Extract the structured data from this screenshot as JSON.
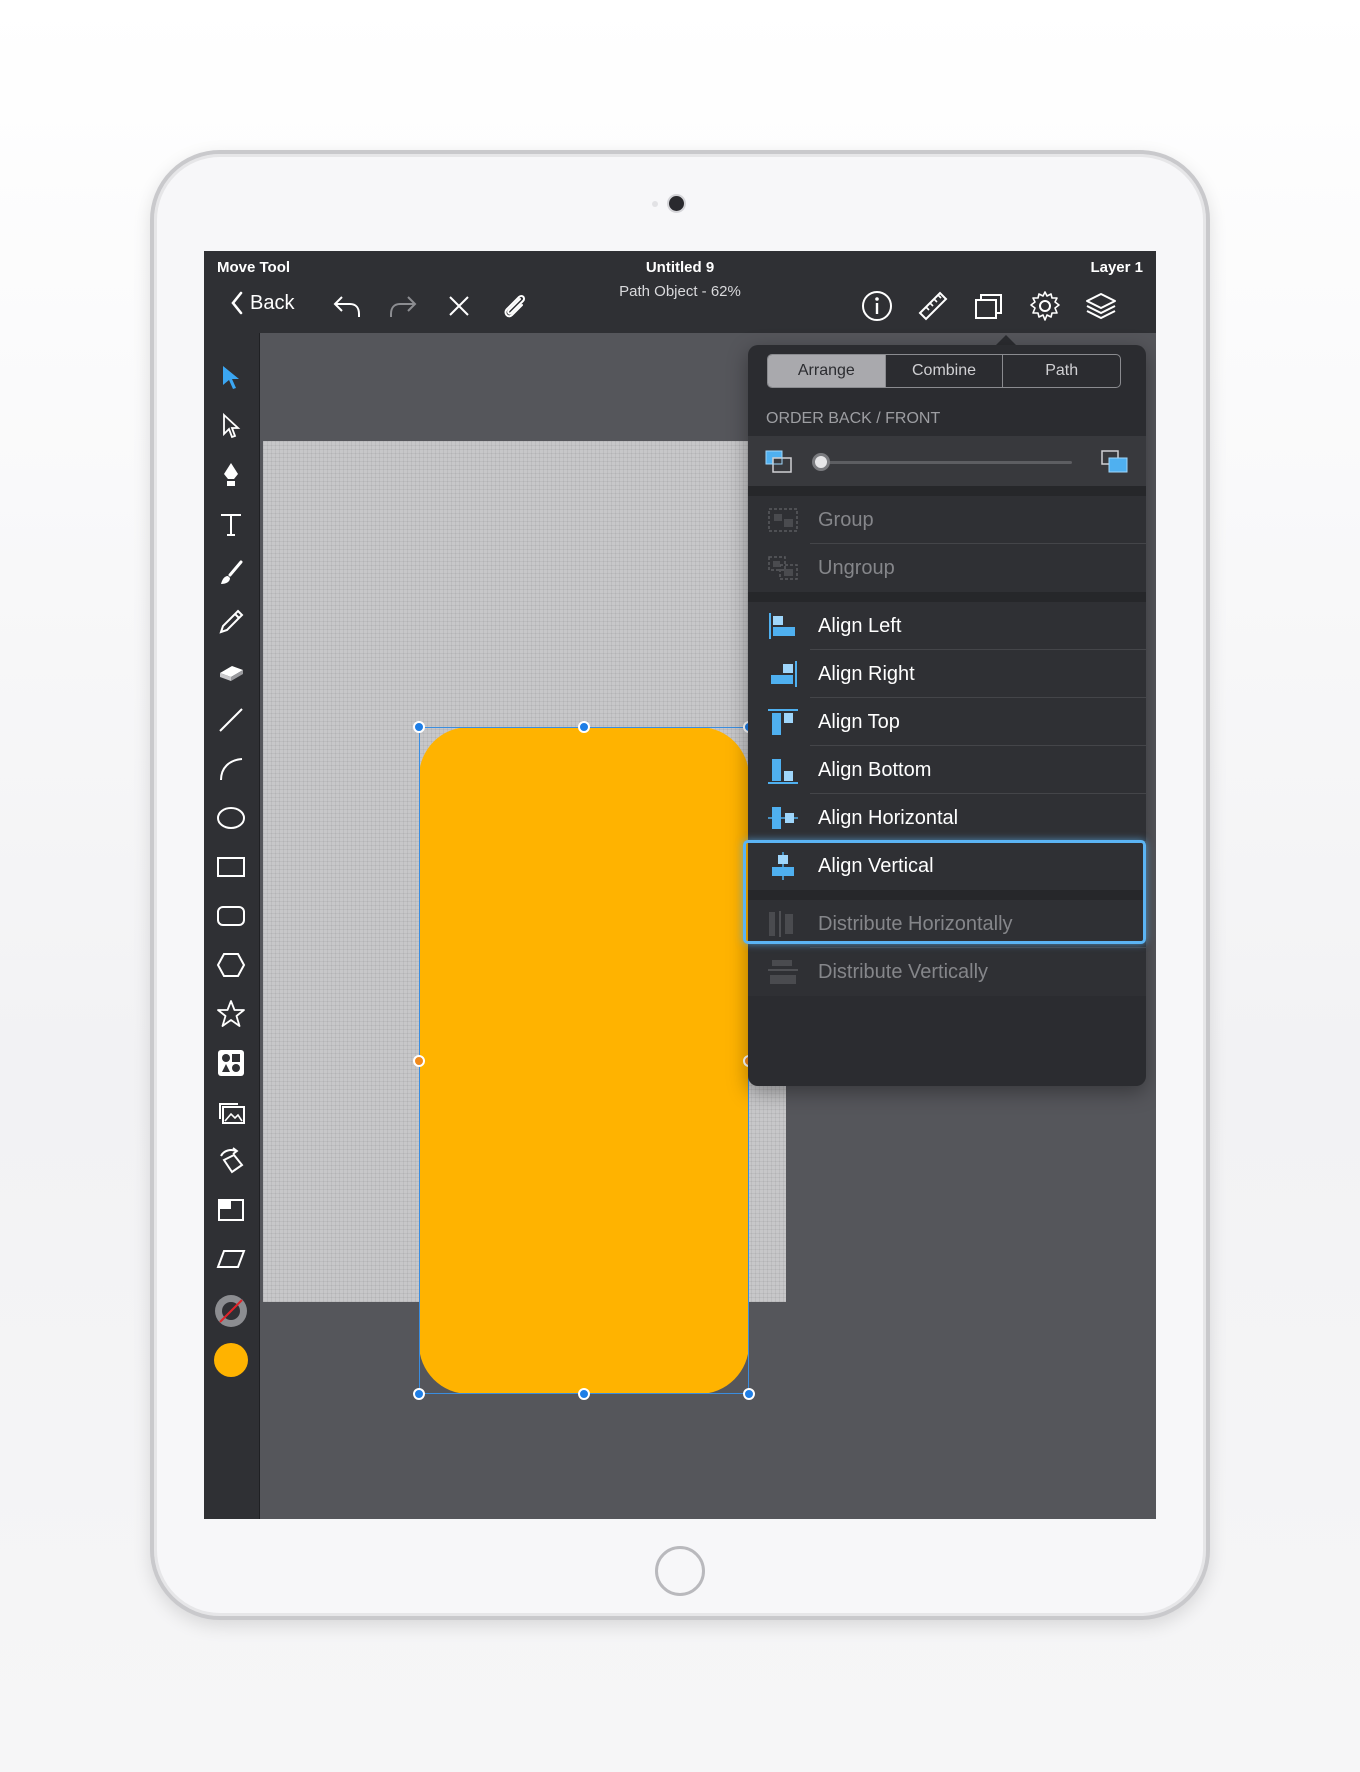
{
  "topbar": {
    "tool_name": "Move Tool",
    "doc_title": "Untitled 9",
    "doc_subtitle": "Path Object - 62%",
    "layer_name": "Layer 1",
    "back_label": "Back"
  },
  "popover": {
    "tabs": [
      "Arrange",
      "Combine",
      "Path"
    ],
    "active_tab": "Arrange",
    "order_section_label": "ORDER BACK / FRONT",
    "order_slider_value": 0,
    "items": {
      "group": "Group",
      "ungroup": "Ungroup",
      "align_left": "Align Left",
      "align_right": "Align Right",
      "align_top": "Align Top",
      "align_bottom": "Align Bottom",
      "align_horizontal": "Align Horizontal",
      "align_vertical": "Align Vertical",
      "distribute_horizontally": "Distribute Horizontally",
      "distribute_vertically": "Distribute Vertically"
    }
  },
  "colors": {
    "fill": "#ffb300",
    "accent": "#4fb0f0",
    "selection": "#1e7ee6"
  }
}
